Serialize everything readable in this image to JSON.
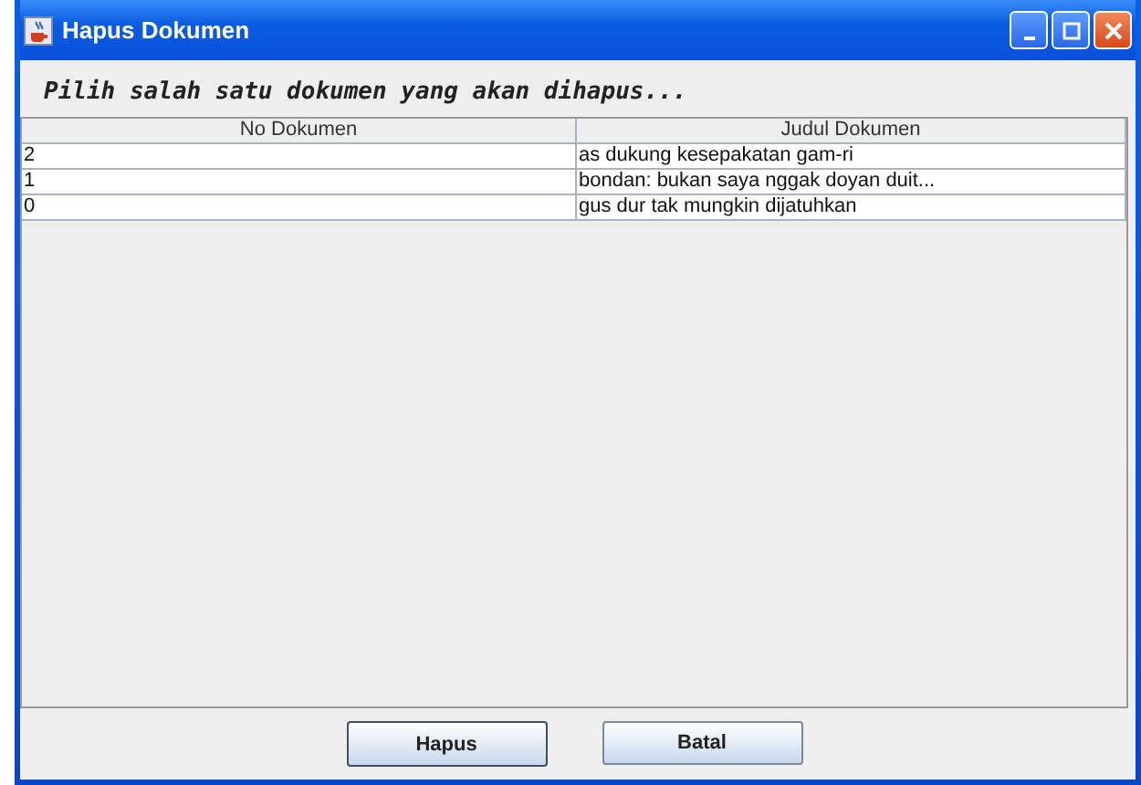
{
  "window": {
    "title": "Hapus Dokumen"
  },
  "instruction": "Pilih salah satu dokumen yang akan dihapus...",
  "table": {
    "columns": [
      "No Dokumen",
      "Judul Dokumen"
    ],
    "rows": [
      [
        "2",
        "as dukung kesepakatan gam-ri"
      ],
      [
        "1",
        "bondan: bukan saya nggak doyan duit..."
      ],
      [
        "0",
        "gus dur tak mungkin dijatuhkan"
      ]
    ]
  },
  "buttons": [
    {
      "label": "Hapus",
      "default": true
    },
    {
      "label": "Batal",
      "default": false
    }
  ]
}
